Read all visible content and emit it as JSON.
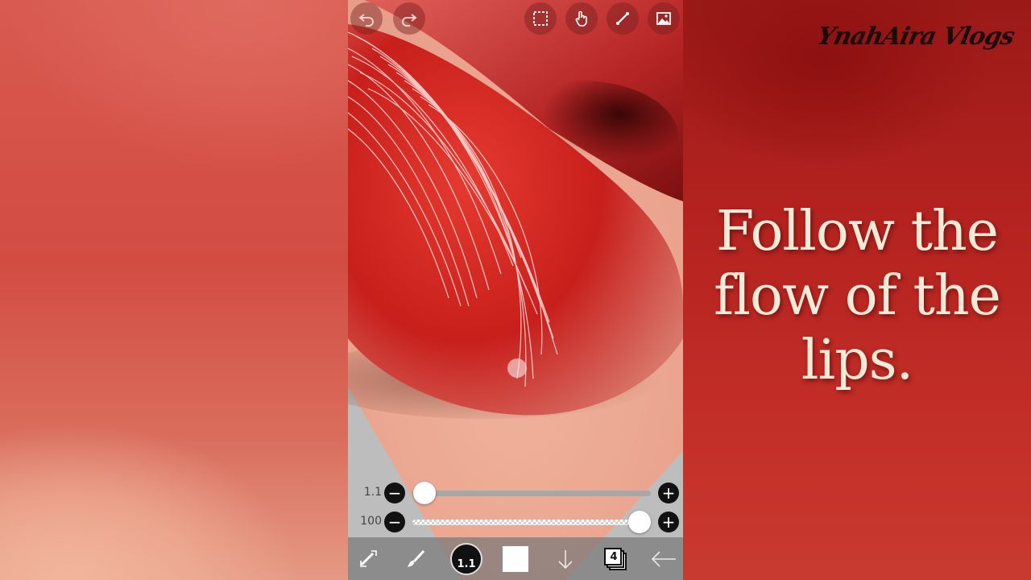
{
  "overlay": {
    "watermark": "YnahAira Vlogs",
    "caption_line1": "Follow the",
    "caption_line2": "flow of the",
    "caption_line3": "lips."
  },
  "app": {
    "top_toolbar": {
      "undo_icon": "undo-arrow-icon",
      "redo_icon": "redo-arrow-icon",
      "tools": [
        "selection-icon",
        "hand-icon",
        "ruler-icon",
        "image-icon"
      ]
    },
    "brush_size": {
      "value_label": "1.1",
      "level": 0.05
    },
    "opacity": {
      "value_label": "100",
      "level": 1.0
    },
    "bottom_bar": {
      "brush_size_label": "1.1",
      "layer_count": "4",
      "color": "#ffffff"
    }
  },
  "colors": {
    "accent_lip": "#c9211f",
    "caption_text": "#f4ead7"
  }
}
